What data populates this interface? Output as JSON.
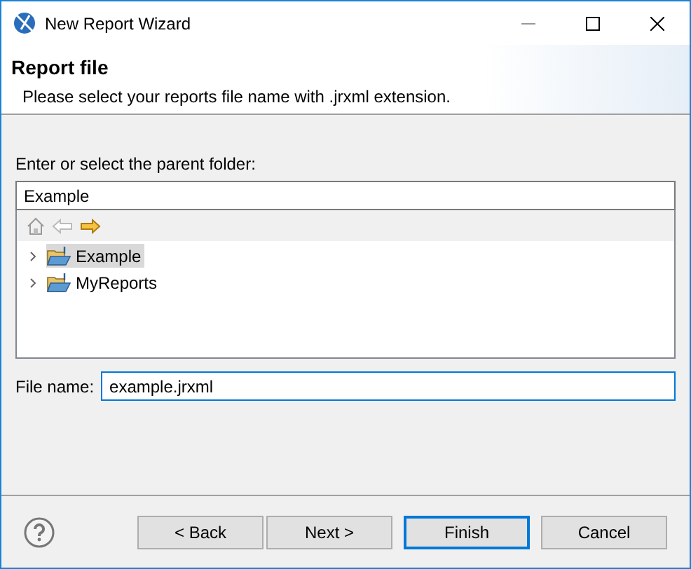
{
  "window": {
    "title": "New Report Wizard"
  },
  "header": {
    "title": "Report file",
    "description": "Please select your reports file name with .jrxml extension."
  },
  "folder": {
    "label": "Enter or select the parent folder:",
    "value": "Example"
  },
  "tree": {
    "items": [
      {
        "label": "Example",
        "selected": true,
        "expanded": false
      },
      {
        "label": "MyReports",
        "selected": false,
        "expanded": false
      }
    ]
  },
  "file_name": {
    "label": "File name:",
    "value": "example.jrxml"
  },
  "buttons": [
    {
      "label": "< Back",
      "default": false
    },
    {
      "label": "Next >",
      "default": false
    },
    {
      "label": "Finish",
      "default": true
    },
    {
      "label": "Cancel",
      "default": false
    }
  ]
}
